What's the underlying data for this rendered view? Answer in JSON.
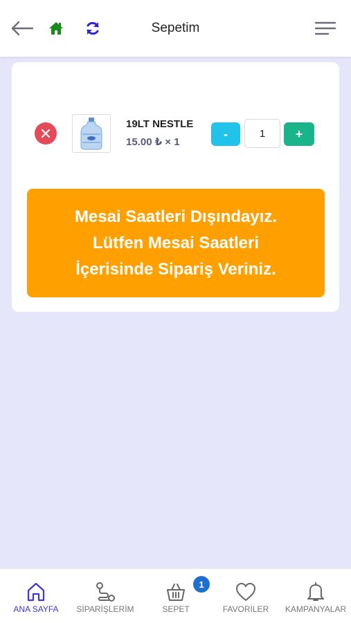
{
  "header": {
    "title": "Sepetim",
    "icons": [
      "back-arrow-icon",
      "home-icon",
      "refresh-icon",
      "menu-icon"
    ]
  },
  "cart": {
    "items": [
      {
        "name": "19LT NESTLE",
        "price_line": "15.00 ₺ × 1",
        "quantity": "1",
        "minus_label": "-",
        "plus_label": "+"
      }
    ]
  },
  "notice": {
    "lines": [
      "Mesai Saatleri Dışındayız.",
      "Lütfen Mesai Saatleri",
      "İçerisinde Sipariş Veriniz."
    ]
  },
  "nav": {
    "items": [
      {
        "label": "ANA SAYFA",
        "icon": "home-outline-icon",
        "active": true
      },
      {
        "label": "SİPARİŞLERİM",
        "icon": "route-icon"
      },
      {
        "label": "SEPET",
        "icon": "basket-icon"
      },
      {
        "label": "FAVORİLER",
        "icon": "heart-icon"
      },
      {
        "label": "KAMPANYALAR",
        "icon": "bell-icon"
      }
    ],
    "basket_badge": "1"
  },
  "colors": {
    "accent": "#3b37d8",
    "notice": "#ffa000",
    "plus": "#19b48a",
    "minus": "#22c3ea",
    "remove": "#e34a5a",
    "background": "#e6e6fb"
  }
}
